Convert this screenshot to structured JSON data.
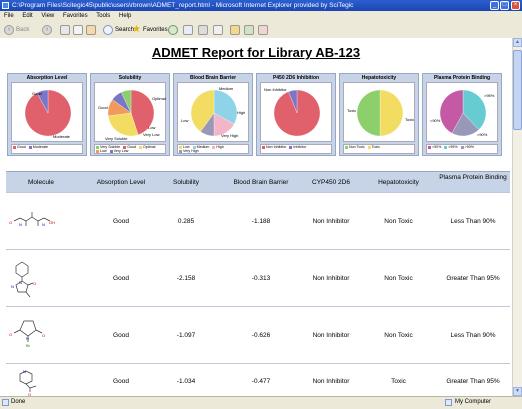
{
  "window": {
    "title": "C:\\Program Files\\Scitegic45\\public\\users\\rbrown\\ADMET_report.html - Microsoft Internet Explorer provided by SciTegic"
  },
  "menu": [
    "File",
    "Edit",
    "View",
    "Favorites",
    "Tools",
    "Help"
  ],
  "toolbar": {
    "back": "Back",
    "search": "Search",
    "favorites": "Favorites"
  },
  "report_title": "ADMET Report for Library AB-123",
  "colors": {
    "red": "#e0606b",
    "blue": "#7a76c9",
    "yellow": "#f3dc62",
    "lightblue": "#8fd3e8",
    "pink": "#f2b6c8",
    "green": "#8ccf6b",
    "magenta": "#c45aa6",
    "teal": "#66ccd1"
  },
  "charts": [
    {
      "title": "Absorption Level",
      "labels": [
        "Good",
        "Moderate"
      ],
      "legend": [
        "Good",
        "Moderate"
      ]
    },
    {
      "title": "Solubility",
      "labels": [
        "Good",
        "Optimal",
        "Low",
        "Very Low",
        "Very Soluble"
      ],
      "legend": [
        "Very Soluble",
        "Good",
        "Optimal",
        "Low",
        "Very Low"
      ]
    },
    {
      "title": "Blood Brain Barrier",
      "labels": [
        "Medium",
        "Low",
        "High",
        "Very High"
      ],
      "legend": [
        "Low",
        "Medium",
        "High",
        "Very High"
      ]
    },
    {
      "title": "P450 2D6 Inhibition",
      "labels": [
        "Non Inhibitor"
      ],
      "legend": [
        "Non Inhibitor",
        "Inhibitor"
      ]
    },
    {
      "title": "Hepatotoxicity",
      "labels": [
        "Toxic",
        "Toxic"
      ],
      "legend": [
        "Non Toxic",
        "Toxic"
      ]
    },
    {
      "title": "Plasma Protein Binding",
      "labels": [
        ">95%",
        "<90%",
        ">90%"
      ],
      "legend": [
        "<90%",
        ">95%",
        ">90%"
      ]
    }
  ],
  "chart_data": [
    {
      "type": "pie",
      "title": "Absorption Level",
      "categories": [
        "Good",
        "Moderate"
      ],
      "values": [
        92,
        8
      ]
    },
    {
      "type": "pie",
      "title": "Solubility",
      "categories": [
        "Good",
        "Optimal",
        "Low",
        "Very Low",
        "Very Soluble"
      ],
      "values": [
        45,
        28,
        12,
        8,
        7
      ]
    },
    {
      "type": "pie",
      "title": "Blood Brain Barrier",
      "categories": [
        "Medium",
        "High",
        "Very High",
        "Low"
      ],
      "values": [
        33,
        17,
        10,
        40
      ]
    },
    {
      "type": "pie",
      "title": "P450 2D6 Inhibition",
      "categories": [
        "Non Inhibitor",
        "Inhibitor"
      ],
      "values": [
        94,
        6
      ]
    },
    {
      "type": "pie",
      "title": "Hepatotoxicity",
      "categories": [
        "Toxic",
        "Non Toxic"
      ],
      "values": [
        50,
        50
      ]
    },
    {
      "type": "pie",
      "title": "Plasma Protein Binding",
      "categories": [
        ">95%",
        ">90%",
        "<90%"
      ],
      "values": [
        38,
        20,
        42
      ]
    }
  ],
  "table": {
    "headers": [
      "Molecule",
      "Absorption Level",
      "Solubility",
      "Blood Brain Barrier",
      "CYP450 2D6",
      "Hepatotoxicity",
      "Plasma Protein Binding"
    ],
    "rows": [
      [
        "Good",
        "0.285",
        "-1.188",
        "Non Inhibitor",
        "Non Toxic",
        "Less Than 90%"
      ],
      [
        "Good",
        "-2.158",
        "-0.313",
        "Non Inhibitor",
        "Non Toxic",
        "Greater Than 95%"
      ],
      [
        "Good",
        "-1.097",
        "-0.626",
        "Non Inhibitor",
        "Non Toxic",
        "Less Than 90%"
      ],
      [
        "Good",
        "-1.034",
        "-0.477",
        "Non Inhibitor",
        "Toxic",
        "Greater Than 95%"
      ]
    ],
    "atoms": {
      "o": "O",
      "n": "N",
      "oh": "OH",
      "br": "Br"
    }
  },
  "status": {
    "left": "Done",
    "right": "My Computer"
  }
}
